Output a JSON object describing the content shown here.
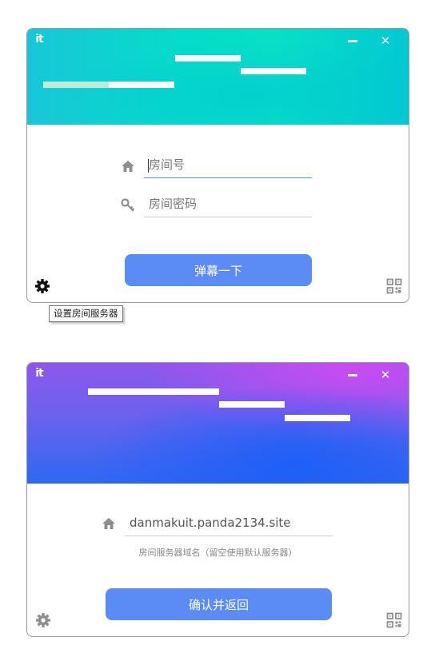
{
  "app": {
    "logo_text": "it"
  },
  "window_controls": {
    "minimize_icon": "minimize-icon",
    "close_icon": "close-icon",
    "close_glyph": "✕"
  },
  "login_window": {
    "room_number_placeholder": "房间号",
    "room_password_placeholder": "房间密码",
    "submit_label": "弹幕一下",
    "settings_icon": "gear-icon",
    "qr_icon": "qr-code-icon",
    "settings_tooltip": "设置房间服务器",
    "accent_gradient": [
      "#19c6d8",
      "#05dcca",
      "#02c8d2"
    ]
  },
  "server_window": {
    "server_address_value": "danmakuit.panda2134.site",
    "server_hint": "房间服务器域名（留空使用默认服务器）",
    "confirm_label": "确认并返回",
    "settings_icon": "gear-icon",
    "qr_icon": "qr-code-icon",
    "accent_gradient": [
      "#8e57ec",
      "#c84cf2",
      "#1e5ff6"
    ]
  },
  "colors": {
    "primary_button": "#5b8bf5",
    "active_underline": "#5b8cf0",
    "icon_gray": "#8f8f8f"
  }
}
